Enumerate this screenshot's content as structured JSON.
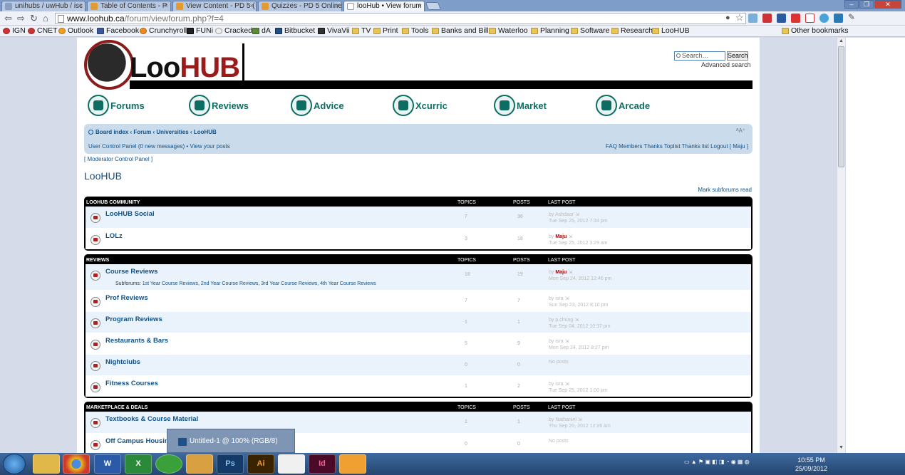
{
  "browser": {
    "tabs": [
      {
        "label": "unihubs / uwHub / isc",
        "active": false
      },
      {
        "label": "Table of Contents - P",
        "active": false
      },
      {
        "label": "View Content - PD 5 (",
        "active": false
      },
      {
        "label": "Quizzes - PD 5 Online",
        "active": false
      },
      {
        "label": "looHub • View forum",
        "active": true
      }
    ],
    "url_host": "www.loohub.ca",
    "url_path": "/forum/viewforum.php?f=4",
    "bookmarks": [
      "IGN",
      "CNET",
      "Outlook",
      "Facebook",
      "Crunchyroll",
      "FUNi",
      "Cracked",
      "dA",
      "Bitbucket",
      "VivaVii",
      "TV",
      "Print",
      "Tools",
      "Banks and Bills",
      "Waterloo",
      "Planning",
      "Software",
      "Research",
      "LooHUB"
    ],
    "other_bookmarks": "Other bookmarks",
    "window_controls": {
      "minimize": "–",
      "restore": "❐",
      "close": "✕"
    }
  },
  "site": {
    "logo_left": "Loo",
    "logo_right": "HUB",
    "search_placeholder": "Search…",
    "search_button": "Search",
    "advanced_search": "Advanced search",
    "nav": [
      "Forums",
      "Reviews",
      "Advice",
      "Xcurric",
      "Market",
      "Arcade"
    ],
    "breadcrumb": "Board index ‹ Forum ‹ Universities ‹ LooHUB",
    "font_control": "ᴬA⁺",
    "ucp": "User Control Panel",
    "ucp_messages": "(0 new messages)",
    "ucp_posts": "View your posts",
    "right_links": "FAQ  Members  Thanks Toplist  Thanks list  Logout [ Maju ]",
    "mcp": "[ Moderator Control Panel ]",
    "forum_title": "LooHUB",
    "mark_read": "Mark subforums read"
  },
  "headers": {
    "topics": "TOPICS",
    "posts": "POSTS",
    "last_post": "LAST POST"
  },
  "categories": [
    {
      "title": "LOOHUB COMMUNITY",
      "forums": [
        {
          "name": "LooHUB Social",
          "topics": "7",
          "posts": "36",
          "lp_by": "by Ashdaar",
          "lp_user": "",
          "lp_date": "Tue Sep 25, 2012 7:34 pm"
        },
        {
          "name": "LOLz",
          "topics": "3",
          "posts": "18",
          "lp_by": "by ",
          "lp_user": "Maju",
          "lp_date": "Tue Sep 25, 2012 3:29 am"
        }
      ]
    },
    {
      "title": "REVIEWS",
      "forums": [
        {
          "name": "Course Reviews",
          "topics": "18",
          "posts": "19",
          "lp_by": "by ",
          "lp_user": "Maju",
          "lp_date": "Mon Sep 24, 2012 12:46 pm",
          "subforums": "Subforums:",
          "sub_list": "1st Year Course Reviews, 2nd Year Course Reviews, 3rd Year Course Reviews, 4th Year Course Reviews"
        },
        {
          "name": "Prof Reviews",
          "topics": "7",
          "posts": "7",
          "lp_by": "by isra",
          "lp_user": "",
          "lp_date": "Sun Sep 23, 2012 8:10 pm"
        },
        {
          "name": "Program Reviews",
          "topics": "1",
          "posts": "1",
          "lp_by": "by p.chung",
          "lp_user": "",
          "lp_date": "Tue Sep 04, 2012 10:37 pm"
        },
        {
          "name": "Restaurants & Bars",
          "topics": "5",
          "posts": "9",
          "lp_by": "by isra",
          "lp_user": "",
          "lp_date": "Mon Sep 24, 2012 8:27 pm"
        },
        {
          "name": "Nightclubs",
          "topics": "0",
          "posts": "0",
          "lp_by": "No posts",
          "lp_user": "",
          "lp_date": ""
        },
        {
          "name": "Fitness Courses",
          "topics": "1",
          "posts": "2",
          "lp_by": "by isra",
          "lp_user": "",
          "lp_date": "Tue Sep 25, 2012 1:00 pm"
        }
      ]
    },
    {
      "title": "MARKETPLACE & DEALS",
      "forums": [
        {
          "name": "Textbooks & Course Material",
          "topics": "1",
          "posts": "1",
          "lp_by": "by Nathaniel",
          "lp_user": "",
          "lp_date": "Thu Sep 20, 2012 12:26 am"
        },
        {
          "name": "Off Campus Housing",
          "topics": "0",
          "posts": "0",
          "lp_by": "No posts",
          "lp_user": "",
          "lp_date": ""
        }
      ]
    }
  ],
  "taskbar": {
    "popup_title": "Untitled-1 @ 100% (RGB/8)",
    "popup_icon_text": "Ps",
    "apps": [
      "",
      "",
      "W",
      "X",
      "",
      "",
      "Ps",
      "Ai",
      "",
      "Id",
      ""
    ],
    "clock_time": "10:55 PM",
    "clock_date": "25/09/2012"
  }
}
